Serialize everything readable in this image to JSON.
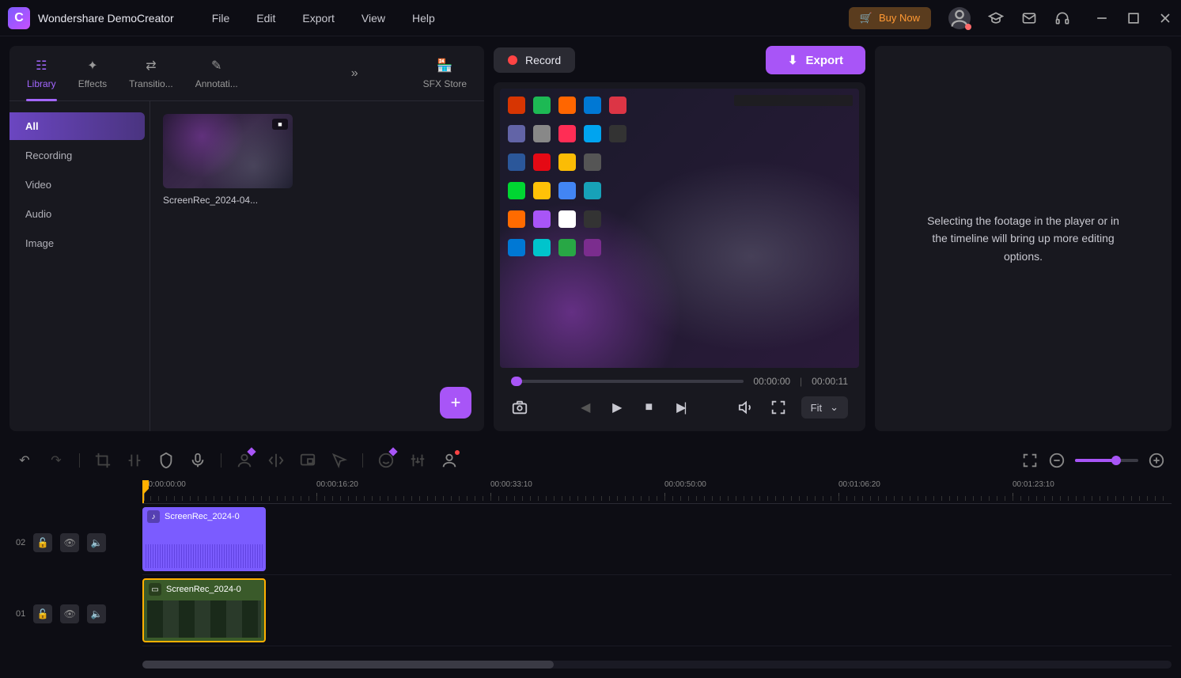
{
  "app": {
    "title": "Wondershare DemoCreator"
  },
  "menubar": [
    "File",
    "Edit",
    "Export",
    "View",
    "Help"
  ],
  "titlebar": {
    "buy_now": "Buy Now"
  },
  "tabs": {
    "library": "Library",
    "effects": "Effects",
    "transitions": "Transitio...",
    "annotations": "Annotati...",
    "sfx": "SFX Store"
  },
  "sidebar": {
    "items": [
      "All",
      "Recording",
      "Video",
      "Audio",
      "Image"
    ],
    "active_index": 0
  },
  "media": {
    "items": [
      {
        "label": "ScreenRec_2024-04..."
      }
    ]
  },
  "preview": {
    "record": "Record",
    "export": "Export",
    "current": "00:00:00",
    "duration": "00:00:11",
    "fit": "Fit"
  },
  "right_hint": "Selecting the footage in the player or in the timeline will bring up more editing options.",
  "timeline": {
    "ruler": [
      "00:00:00:00",
      "00:00:16:20",
      "00:00:33:10",
      "00:00:50:00",
      "00:01:06:20",
      "00:01:23:10"
    ],
    "tracks": [
      {
        "num": "02",
        "clip_label": "ScreenRec_2024-0"
      },
      {
        "num": "01",
        "clip_label": "ScreenRec_2024-0"
      }
    ]
  }
}
